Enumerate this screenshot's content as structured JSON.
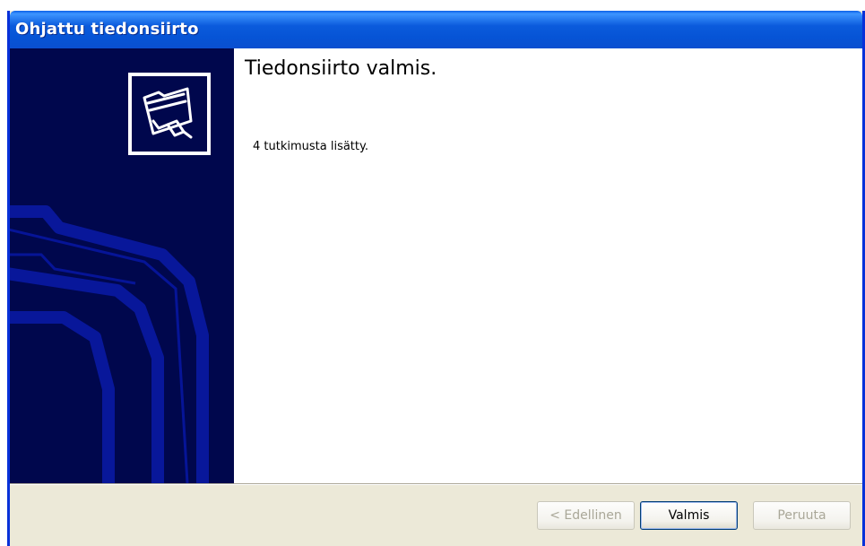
{
  "window": {
    "title": "Ohjattu tiedonsiirto"
  },
  "side_panel": {
    "logo_icon": "folder-transfer-icon"
  },
  "content": {
    "heading": "Tiedonsiirto valmis.",
    "message": "4 tutkimusta lisätty."
  },
  "buttons": {
    "back_label": "< Edellinen",
    "finish_label": "Valmis",
    "cancel_label": "Peruuta"
  },
  "colors": {
    "titlebar": "#0a5fe8",
    "side_panel": "#00074d",
    "window_face": "#ece9d8"
  }
}
